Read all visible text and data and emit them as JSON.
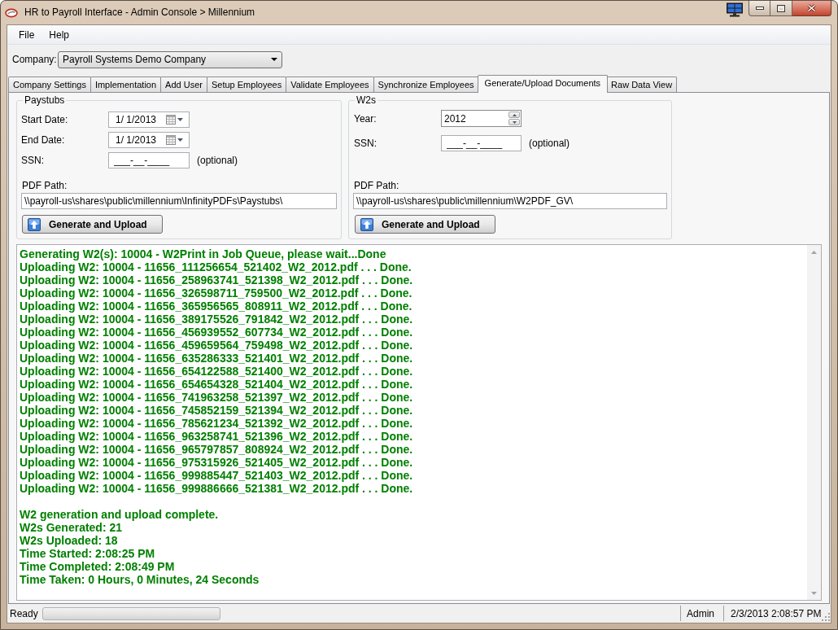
{
  "window": {
    "title": "HR to Payroll Interface - Admin Console > Millennium"
  },
  "menu": [
    {
      "label": "File"
    },
    {
      "label": "Help"
    }
  ],
  "company": {
    "label": "Company:",
    "value": "Payroll Systems Demo Company"
  },
  "tabs": [
    {
      "label": "Company Settings",
      "selected": false
    },
    {
      "label": "Implementation",
      "selected": false
    },
    {
      "label": "Add User",
      "selected": false
    },
    {
      "label": "Setup Employees",
      "selected": false
    },
    {
      "label": "Validate Employees",
      "selected": false
    },
    {
      "label": "Synchronize Employees",
      "selected": false
    },
    {
      "label": "Generate/Upload Documents",
      "selected": true
    },
    {
      "label": "Raw Data View",
      "selected": false
    }
  ],
  "paystubs": {
    "title": "Paystubs",
    "fields": [
      {
        "kind": "date",
        "label": "Start Date:",
        "value": "1/ 1/2013"
      },
      {
        "kind": "date",
        "label": "End Date:",
        "value": "1/ 1/2013"
      },
      {
        "kind": "masked",
        "label": "SSN:",
        "placeholder": "___-__-____",
        "note": "(optional)"
      }
    ],
    "path_label": "PDF Path:",
    "path": "\\\\payroll-us\\shares\\public\\millennium\\InfinityPDFs\\Paystubs\\",
    "button": "Generate and Upload"
  },
  "w2s": {
    "title": "W2s",
    "fields": [
      {
        "kind": "spinner",
        "label": "Year:",
        "value": "2012"
      },
      {
        "kind": "masked",
        "label": "SSN:",
        "placeholder": "___-__-____",
        "note": "(optional)"
      }
    ],
    "path_label": "PDF Path:",
    "path": "\\\\payroll-us\\shares\\public\\millennium\\W2PDF_GV\\",
    "button": "Generate and Upload"
  },
  "log": {
    "lines": [
      "Generating W2(s): 10004 - W2Print in Job Queue, please wait...Done",
      "Uploading W2: 10004 - 11656_111256654_521402_W2_2012.pdf . . . Done.",
      "Uploading W2: 10004 - 11656_258963741_521398_W2_2012.pdf . . . Done.",
      "Uploading W2: 10004 - 11656_326598711_759500_W2_2012.pdf . . . Done.",
      "Uploading W2: 10004 - 11656_365956565_808911_W2_2012.pdf . . . Done.",
      "Uploading W2: 10004 - 11656_389175526_791842_W2_2012.pdf . . . Done.",
      "Uploading W2: 10004 - 11656_456939552_607734_W2_2012.pdf . . . Done.",
      "Uploading W2: 10004 - 11656_459659564_759498_W2_2012.pdf . . . Done.",
      "Uploading W2: 10004 - 11656_635286333_521401_W2_2012.pdf . . . Done.",
      "Uploading W2: 10004 - 11656_654122588_521400_W2_2012.pdf . . . Done.",
      "Uploading W2: 10004 - 11656_654654328_521404_W2_2012.pdf . . . Done.",
      "Uploading W2: 10004 - 11656_741963258_521397_W2_2012.pdf . . . Done.",
      "Uploading W2: 10004 - 11656_745852159_521394_W2_2012.pdf . . . Done.",
      "Uploading W2: 10004 - 11656_785621234_521392_W2_2012.pdf . . . Done.",
      "Uploading W2: 10004 - 11656_963258741_521396_W2_2012.pdf . . . Done.",
      "Uploading W2: 10004 - 11656_965797857_808924_W2_2012.pdf . . . Done.",
      "Uploading W2: 10004 - 11656_975315926_521405_W2_2012.pdf . . . Done.",
      "Uploading W2: 10004 - 11656_999885447_521403_W2_2012.pdf . . . Done.",
      "Uploading W2: 10004 - 11656_999886666_521381_W2_2012.pdf . . . Done."
    ],
    "summary": [
      "W2 generation and upload complete.",
      "W2s Generated: 21",
      "W2s Uploaded: 18",
      "Time Started: 2:08:25 PM",
      "Time Completed: 2:08:49 PM",
      "Time Taken: 0 Hours, 0 Minutes, 24 Seconds"
    ]
  },
  "status_bar": {
    "status": "Ready",
    "progress": {
      "level": 0
    },
    "user": "Admin",
    "datetime": "2/3/2013 2:08:57 PM"
  }
}
